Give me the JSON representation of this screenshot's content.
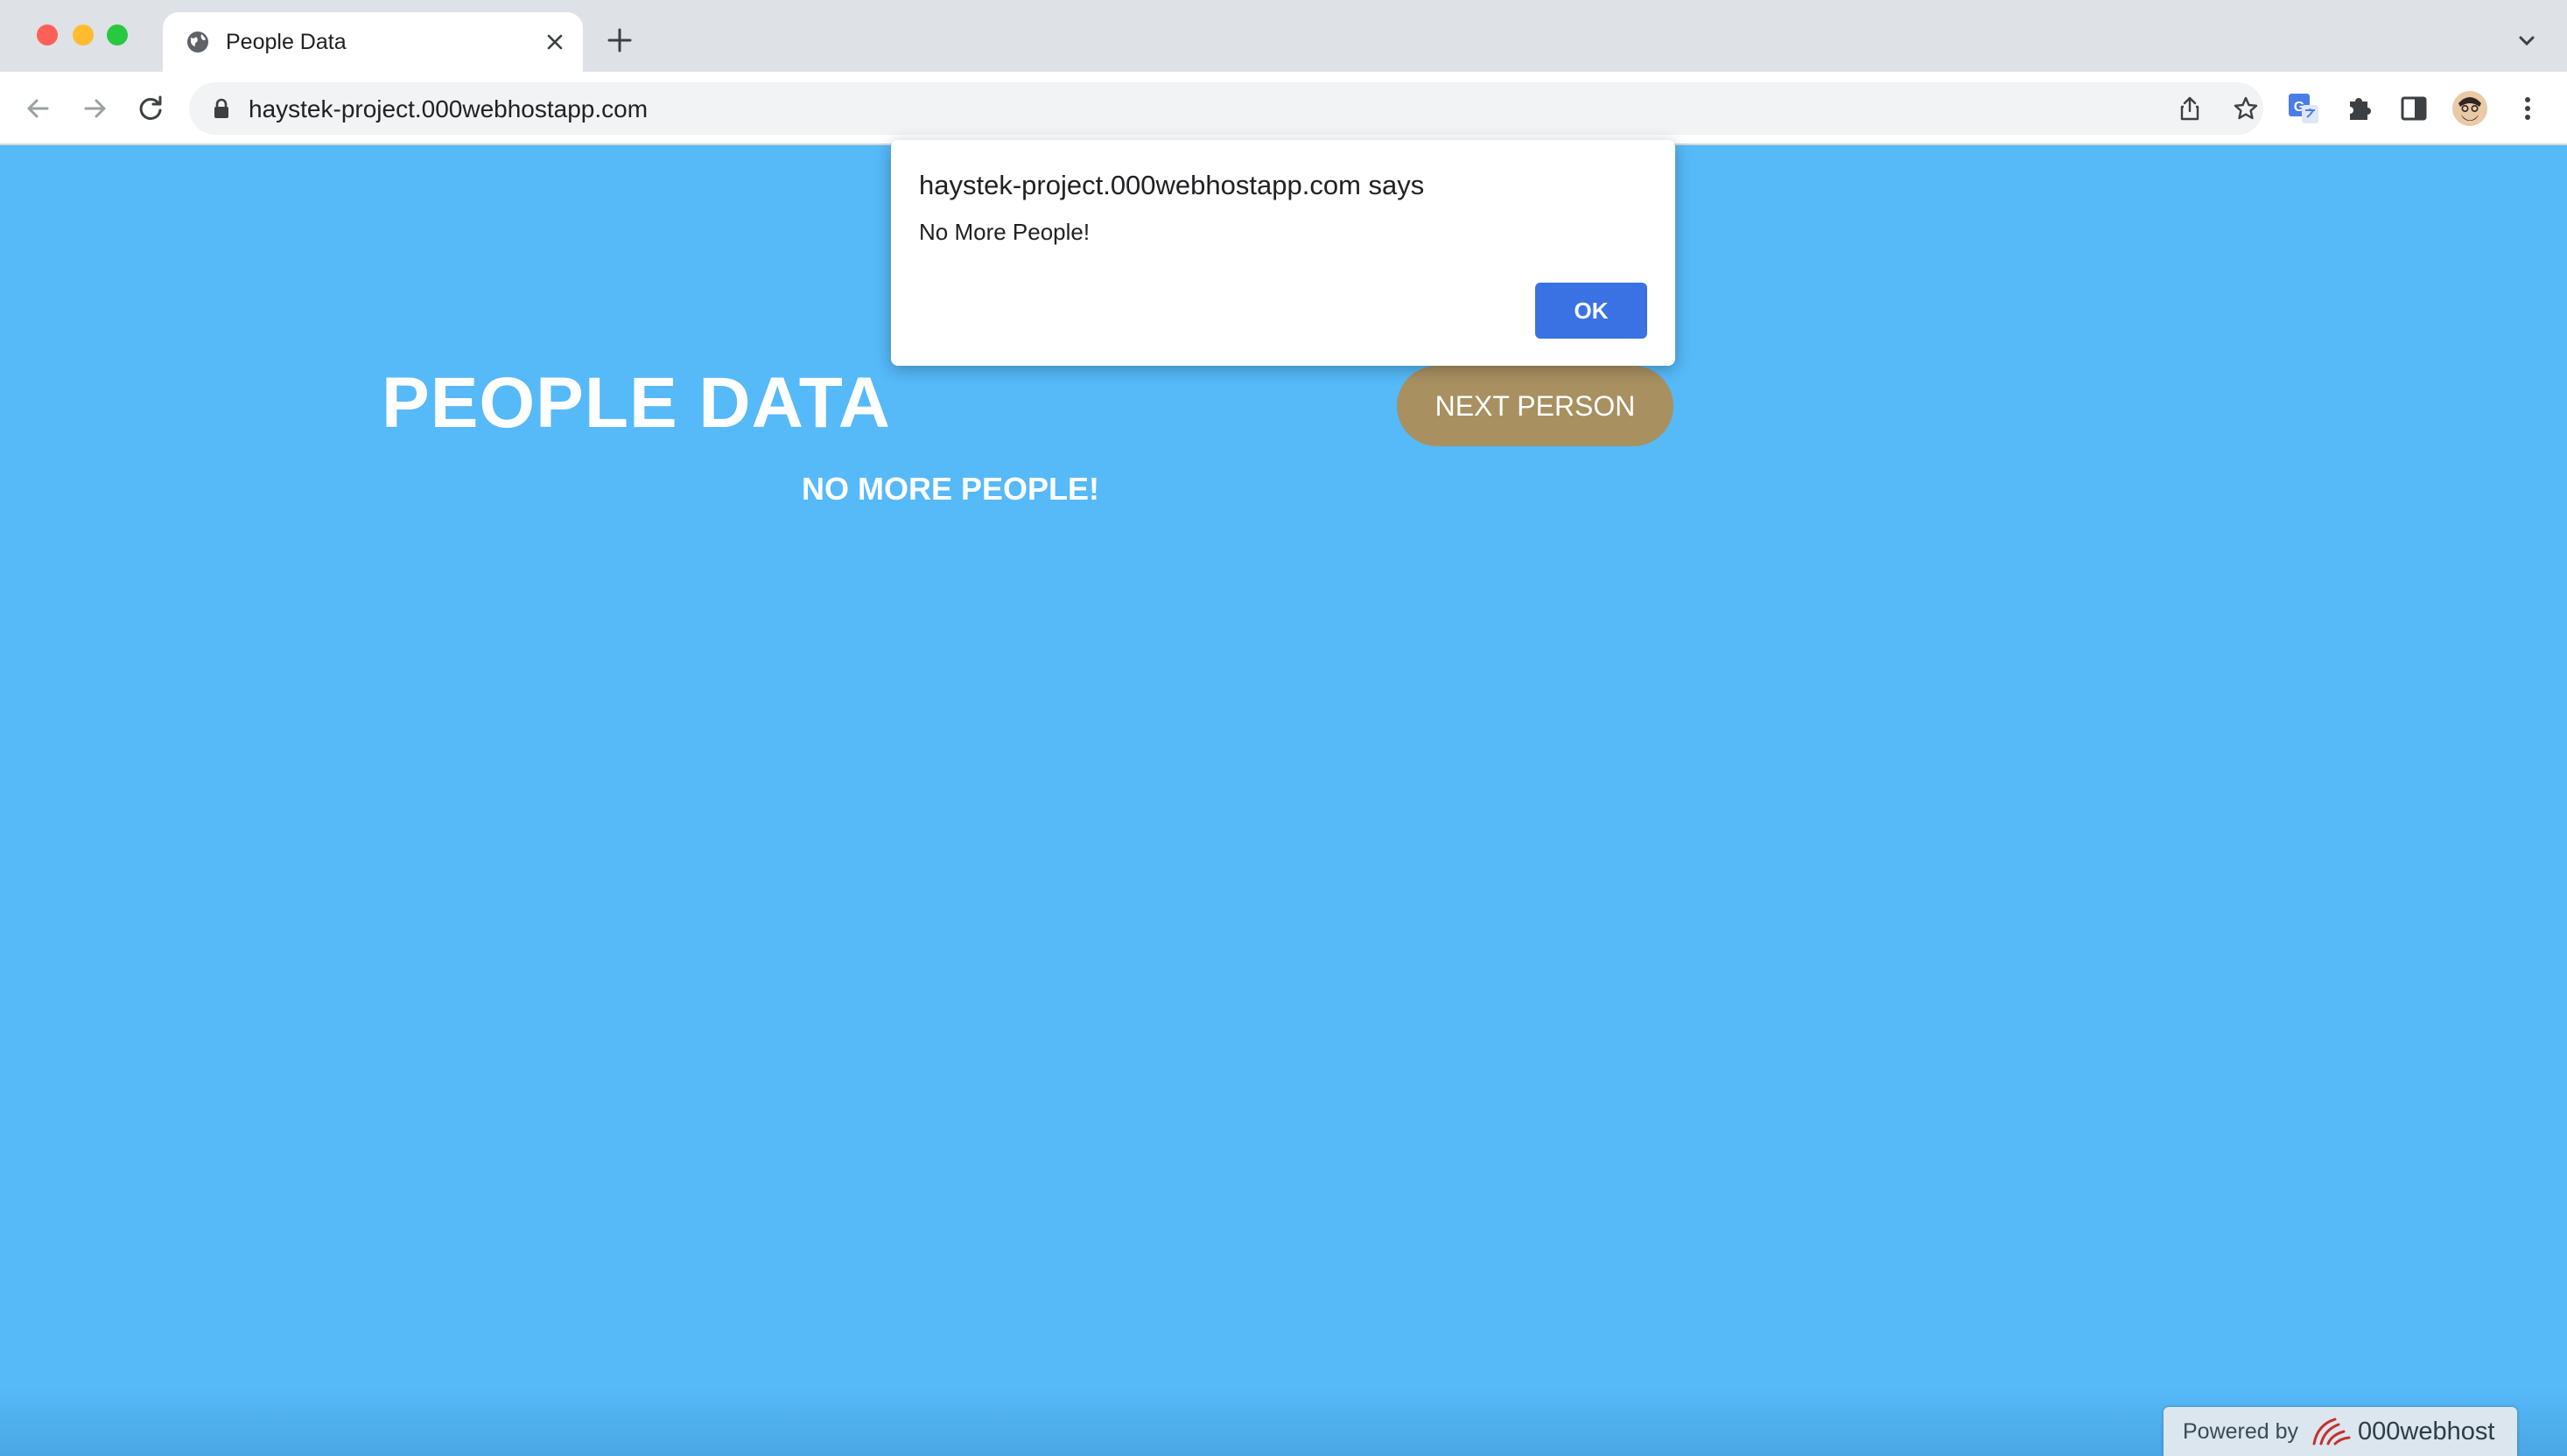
{
  "browser": {
    "tab": {
      "title": "People Data"
    },
    "address_bar": {
      "url": "haystek-project.000webhostapp.com"
    }
  },
  "page": {
    "title": "PEOPLE DATA",
    "next_button_label": "NEXT PERSON",
    "status_message": "NO MORE PEOPLE!",
    "powered_by": {
      "label": "Powered by",
      "brand": "000webhost"
    },
    "background_color": "#56b9f8",
    "button_color": "#a89060"
  },
  "dialog": {
    "title": "haystek-project.000webhostapp.com says",
    "message": "No More People!",
    "ok_label": "OK",
    "ok_color": "#3a72e3"
  }
}
